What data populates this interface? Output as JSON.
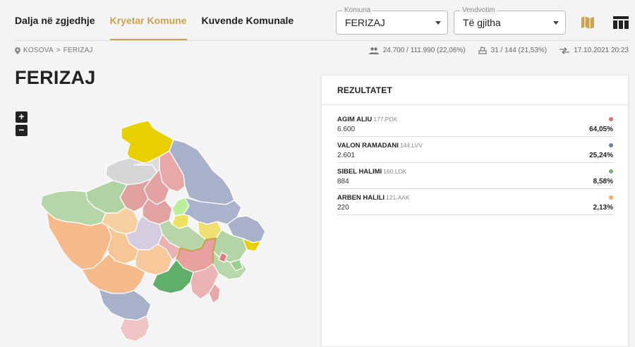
{
  "nav": {
    "tabs": [
      {
        "label": "Dalja në zgjedhje"
      },
      {
        "label": "Kryetar Komune"
      },
      {
        "label": "Kuvende Komunale"
      }
    ],
    "active_tab": "Kryetar Komune"
  },
  "filters": {
    "komuna": {
      "legend": "Komuna",
      "value": "FERIZAJ"
    },
    "vendvotim": {
      "legend": "Vendvotim",
      "value": "Të gjitha"
    }
  },
  "toolbar": {
    "map_icon": "map-icon",
    "table_icon": "table-icon"
  },
  "breadcrumb": {
    "root": "KOSOVA",
    "separator": ">",
    "current": "FERIZAJ"
  },
  "stats": {
    "turnout": "24.700 / 111.990 (22,06%)",
    "stations": "31 / 144 (21,53%)",
    "updated": "17.10.2021 20:23"
  },
  "page": {
    "title": "FERIZAJ"
  },
  "zoom": {
    "in": "+",
    "out": "−"
  },
  "results": {
    "title": "REZULTATET",
    "candidates": [
      {
        "name": "AGIM ALIU",
        "party": "177.PDK",
        "votes": "6.600",
        "percent": "64,05%",
        "color": "#e07070"
      },
      {
        "name": "VALON RAMADANI",
        "party": "144.LVV",
        "votes": "2.601",
        "percent": "25,24%",
        "color": "#6a7fb0"
      },
      {
        "name": "SIBEL HALIMI",
        "party": "160.LDK",
        "votes": "884",
        "percent": "8,58%",
        "color": "#6db56d"
      },
      {
        "name": "ARBEN HALILI",
        "party": "121.AAK",
        "votes": "220",
        "percent": "2,13%",
        "color": "#f2a85e"
      }
    ]
  },
  "colors": {
    "accent": "#c9a34e",
    "pdk": "#e07070",
    "lvv": "#6a7fb0",
    "ldk": "#6db56d",
    "aak": "#f2a85e",
    "srpska": "#e8d000"
  }
}
